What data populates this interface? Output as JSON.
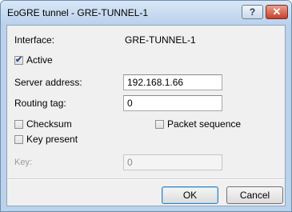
{
  "window": {
    "title": "EoGRE tunnel - GRE-TUNNEL-1",
    "help_symbol": "?",
    "close_symbol": "✕"
  },
  "form": {
    "interface_label": "Interface:",
    "interface_value": "GRE-TUNNEL-1",
    "active": {
      "label": "Active",
      "checked": true
    },
    "server_address": {
      "label": "Server address:",
      "value": "192.168.1.66"
    },
    "routing_tag": {
      "label": "Routing tag:",
      "value": "0"
    },
    "checksum": {
      "label": "Checksum",
      "checked": false
    },
    "packet_sequence": {
      "label": "Packet sequence",
      "checked": false
    },
    "key_present": {
      "label": "Key present",
      "checked": false
    },
    "key": {
      "label": "Key:",
      "value": "0"
    }
  },
  "buttons": {
    "ok": "OK",
    "cancel": "Cancel"
  }
}
